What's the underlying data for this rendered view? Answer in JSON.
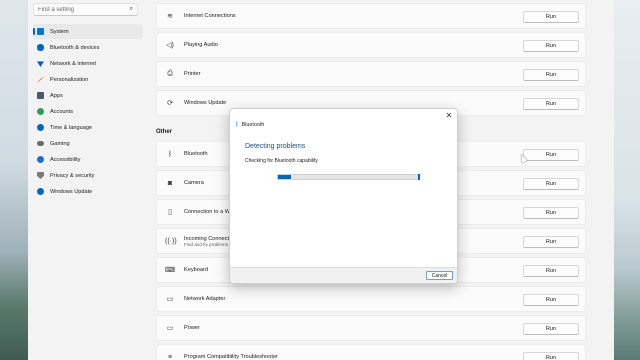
{
  "search": {
    "placeholder": "Find a setting",
    "icon": "search-icon"
  },
  "sidebar": {
    "items": [
      {
        "label": "System",
        "icon": "monitor-icon",
        "color": "#0078d4",
        "active": true
      },
      {
        "label": "Bluetooth & devices",
        "icon": "bluetooth-icon",
        "color": "#0067c0"
      },
      {
        "label": "Network & internet",
        "icon": "wifi-icon",
        "color": "#0067c0"
      },
      {
        "label": "Personalization",
        "icon": "brush-icon",
        "color": "#c2700d"
      },
      {
        "label": "Apps",
        "icon": "apps-icon",
        "color": "#4a5b6b"
      },
      {
        "label": "Accounts",
        "icon": "account-icon",
        "color": "#2f9e5c"
      },
      {
        "label": "Time & language",
        "icon": "globe-clock-icon",
        "color": "#0067c0"
      },
      {
        "label": "Gaming",
        "icon": "gamepad-icon",
        "color": "#6b6b6b"
      },
      {
        "label": "Accessibility",
        "icon": "accessibility-icon",
        "color": "#1f6fc5"
      },
      {
        "label": "Privacy & security",
        "icon": "shield-icon",
        "color": "#7a7a7a"
      },
      {
        "label": "Windows Update",
        "icon": "update-icon",
        "color": "#0067c0"
      }
    ]
  },
  "main": {
    "top_rows": [
      {
        "label": "Internet Connections",
        "icon": "wifi-icon",
        "button": "Run"
      },
      {
        "label": "Playing Audio",
        "icon": "speaker-icon",
        "button": "Run"
      },
      {
        "label": "Printer",
        "icon": "printer-icon",
        "button": "Run"
      },
      {
        "label": "Windows Update",
        "icon": "update-icon",
        "button": "Run"
      }
    ],
    "other_title": "Other",
    "other_rows": [
      {
        "label": "Bluetooth",
        "icon": "bluetooth-icon",
        "button": "Run"
      },
      {
        "label": "Camera",
        "icon": "camera-icon",
        "button": "Run"
      },
      {
        "label": "Connection to a Wo",
        "icon": "device-icon",
        "button": "Run"
      },
      {
        "label": "Incoming Connectic",
        "sublabel": "Find and fix problems",
        "icon": "incoming-icon",
        "button": "Run"
      },
      {
        "label": "Keyboard",
        "icon": "keyboard-icon",
        "button": "Run"
      },
      {
        "label": "Network Adapter",
        "icon": "network-adapter-icon",
        "button": "Run"
      },
      {
        "label": "Power",
        "icon": "power-icon",
        "button": "Run"
      },
      {
        "label": "Program Compatibility Troubleshooter",
        "icon": "list-icon",
        "button": "Run"
      }
    ]
  },
  "dialog": {
    "title": "Bluetooth",
    "heading": "Detecting problems",
    "status": "Checking for Bluetooth capability",
    "progress": 0.09,
    "close": "✕",
    "cancel": "Cancel",
    "accent": "#0b62b6"
  }
}
